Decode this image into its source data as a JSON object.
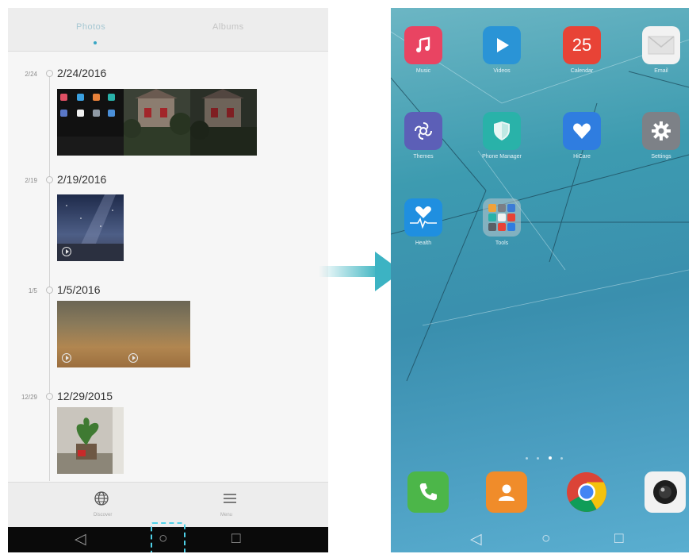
{
  "gallery": {
    "tabs": [
      {
        "label": "Photos",
        "active": true
      },
      {
        "label": "Albums",
        "active": false
      }
    ],
    "timeline": [
      {
        "short_date": "2/24",
        "date": "2/24/2016",
        "items": [
          {
            "kind": "photo",
            "subject": "home-screen-screenshot"
          },
          {
            "kind": "photo",
            "subject": "stone-house"
          },
          {
            "kind": "photo",
            "subject": "stone-house-dark"
          }
        ]
      },
      {
        "short_date": "2/19",
        "date": "2/19/2016",
        "items": [
          {
            "kind": "video",
            "subject": "night-sky"
          }
        ]
      },
      {
        "short_date": "1/5",
        "date": "1/5/2016",
        "items": [
          {
            "kind": "video",
            "subject": "blurry-wood"
          },
          {
            "kind": "video",
            "subject": "blurry-wood"
          }
        ]
      },
      {
        "short_date": "12/29",
        "date": "12/29/2015",
        "items": [
          {
            "kind": "photo",
            "subject": "potted-plant"
          }
        ]
      }
    ],
    "bottom_bar": [
      {
        "icon": "globe-icon",
        "label": "Discover"
      },
      {
        "icon": "menu-icon",
        "label": "Menu"
      }
    ]
  },
  "navigation": {
    "buttons": [
      {
        "name": "back",
        "glyph": "◁"
      },
      {
        "name": "home",
        "glyph": "○"
      },
      {
        "name": "recents",
        "glyph": "□"
      }
    ],
    "highlighted": "home"
  },
  "home": {
    "apps": [
      {
        "label": "Music",
        "icon": "music-icon",
        "color": "#e94462"
      },
      {
        "label": "Videos",
        "icon": "play-icon",
        "color": "#2a94d6"
      },
      {
        "label": "Calendar",
        "icon": "calendar-icon",
        "color": "#e84336",
        "text": "25"
      },
      {
        "label": "Email",
        "icon": "mail-icon",
        "color": "#f2f2f2"
      },
      {
        "label": "Themes",
        "icon": "themes-icon",
        "color": "#5c5fb7"
      },
      {
        "label": "Phone Manager",
        "icon": "shield-icon",
        "color": "#29b2a9"
      },
      {
        "label": "HiCare",
        "icon": "heart-icon",
        "color": "#2f7de0"
      },
      {
        "label": "Settings",
        "icon": "gear-icon",
        "color": "#7d8187"
      },
      {
        "label": "Health",
        "icon": "health-icon",
        "color": "#1f8fe0"
      },
      {
        "label": "Tools",
        "icon": "folder-icon",
        "color": "#8d98a3"
      }
    ],
    "page_count": 4,
    "active_page": 3,
    "dock": [
      {
        "name": "phone",
        "icon": "phone-icon",
        "color": "#4cb649"
      },
      {
        "name": "contacts",
        "icon": "contacts-icon",
        "color": "#f08c2a"
      },
      {
        "name": "chrome",
        "icon": "chrome-icon",
        "color": "#ffffff"
      },
      {
        "name": "camera",
        "icon": "camera-icon",
        "color": "#f2f2f2"
      }
    ]
  }
}
